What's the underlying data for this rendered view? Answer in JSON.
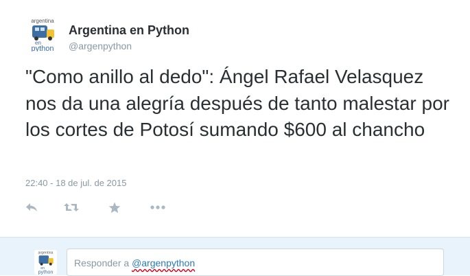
{
  "tweet": {
    "avatar_text": {
      "top": "argentina",
      "middle": "en",
      "bottom": "python"
    },
    "fullname": "Argentina en Python",
    "username": "@argenpython",
    "text": "\"Como anillo al dedo\": Ángel Rafael Velasquez nos da una alegría después de tanto malestar por los cortes de Potosí sumando $600 al chancho",
    "timestamp": "22:40 - 18 de jul. de 2015",
    "actions": [
      {
        "name": "reply",
        "icon": "reply-icon"
      },
      {
        "name": "retweet",
        "icon": "retweet-icon"
      },
      {
        "name": "favorite",
        "icon": "star-icon"
      },
      {
        "name": "more",
        "icon": "more-icon"
      }
    ]
  },
  "reply": {
    "prefix": "Responder a",
    "handle": "@argenpython"
  },
  "colors": {
    "text": "#292f33",
    "muted": "#8899a6",
    "link": "#2b7bb9",
    "reply_bg": "#e8f3fb",
    "logo_blue": "#3b6ea5",
    "logo_yellow": "#f2c230"
  }
}
